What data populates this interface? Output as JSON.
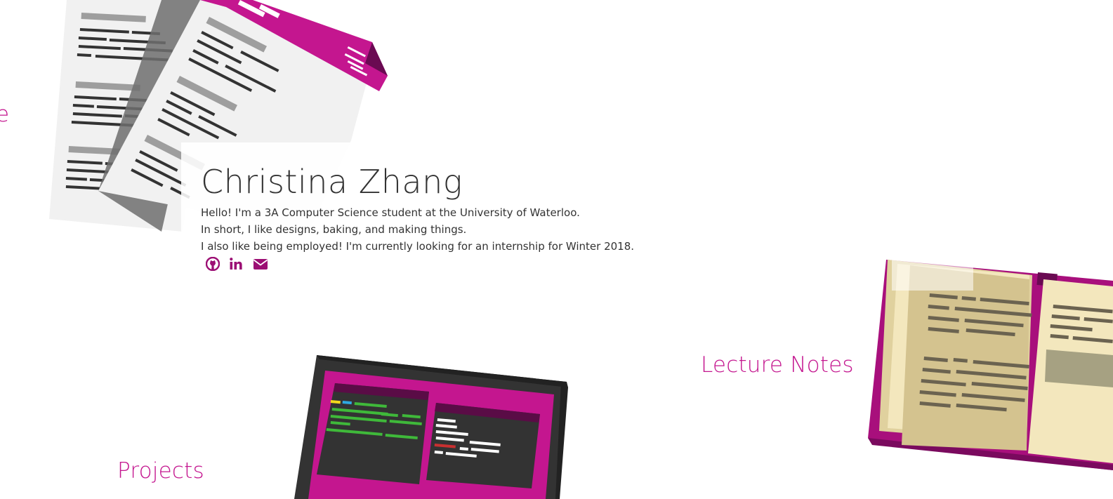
{
  "profile": {
    "name": "Christina Zhang",
    "lines": [
      "Hello! I'm a 3A Computer Science student at the University of Waterloo.",
      "In short, I like designs, baking, and making things.",
      "I also like being employed! I'm currently looking for an internship for Winter 2018."
    ]
  },
  "social_links": [
    {
      "name": "github",
      "icon": "github-icon"
    },
    {
      "name": "linkedin",
      "icon": "linkedin-icon"
    },
    {
      "name": "email",
      "icon": "envelope-icon"
    }
  ],
  "sections": {
    "partial_left": "e",
    "lecture_notes": "Lecture Notes",
    "projects": "Projects"
  },
  "colors": {
    "accent": "#c4168f",
    "dark_accent": "#7a0a5e",
    "text": "#333333"
  }
}
